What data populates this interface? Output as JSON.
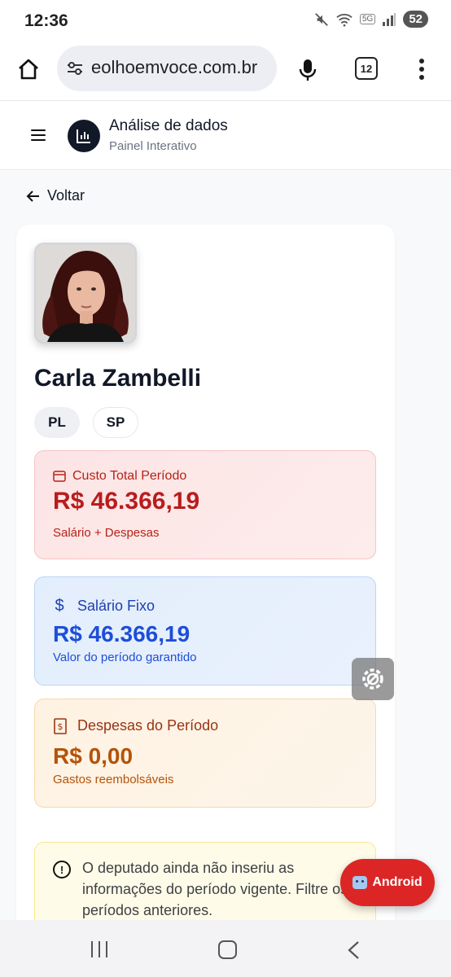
{
  "status_bar": {
    "time": "12:36",
    "network": "5G",
    "battery": "52"
  },
  "browser": {
    "url": "eolhoemvoce.com.br",
    "tab_count": "12"
  },
  "app": {
    "title": "Análise de dados",
    "subtitle": "Painel Interativo"
  },
  "nav": {
    "back_label": "Voltar"
  },
  "profile": {
    "name": "Carla Zambelli",
    "party": "PL",
    "state": "SP"
  },
  "stats": {
    "total": {
      "label": "Custo Total Período",
      "value": "R$ 46.366,19",
      "sub": "Salário + Despesas"
    },
    "salary": {
      "label": "Salário Fixo",
      "value": "R$ 46.366,19",
      "sub": "Valor do período garantido"
    },
    "expenses": {
      "label": "Despesas do Período",
      "value": "R$ 0,00",
      "sub": "Gastos reembolsáveis"
    }
  },
  "notice": {
    "text": "O deputado ainda não inseriu as informações do período vigente. Filtre os períodos anteriores."
  },
  "floating": {
    "android_label": "Android"
  },
  "colors": {
    "total": "#b91c1c",
    "salary": "#1d4ed8",
    "expenses": "#b45309",
    "fab": "#dc2626"
  }
}
